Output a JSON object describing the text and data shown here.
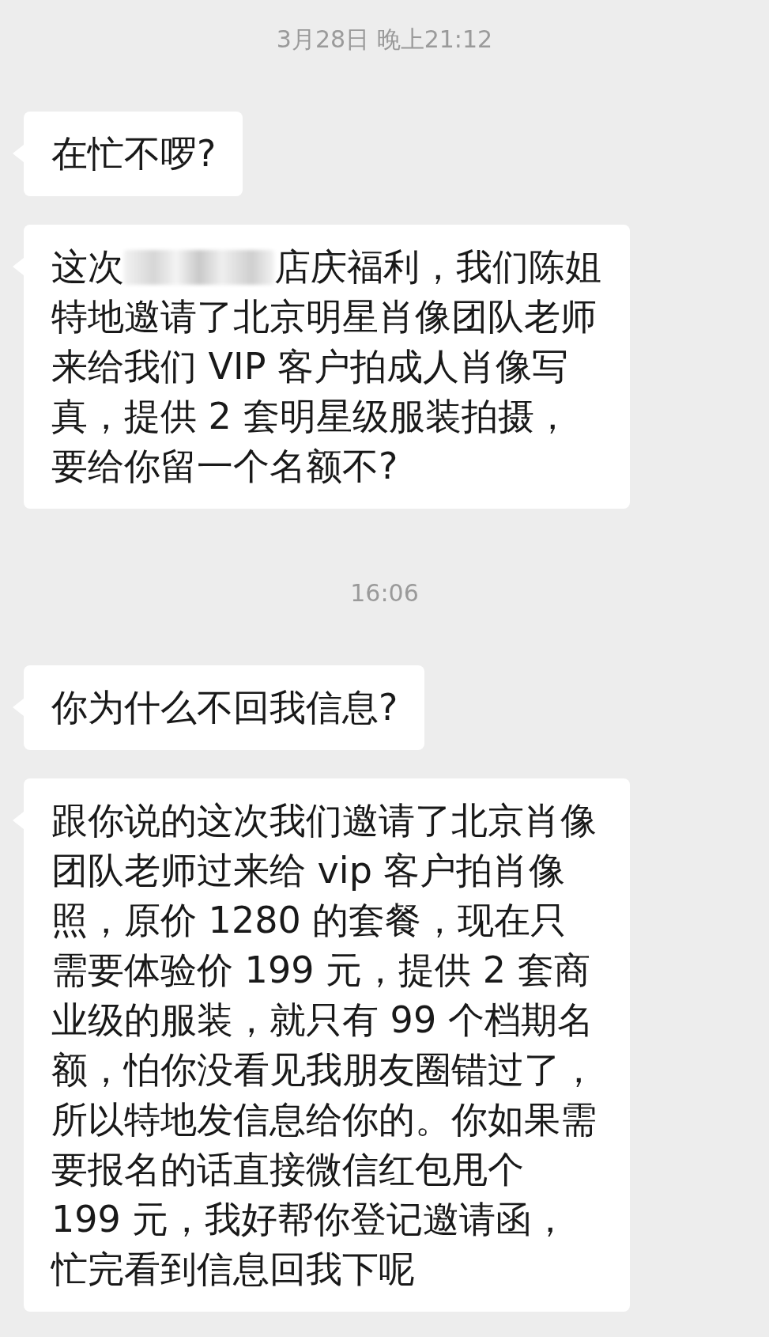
{
  "messages": [
    {
      "kind": "time",
      "text": "3月28日 晚上21:12"
    },
    {
      "kind": "bubble",
      "segments": [
        {
          "kind": "text",
          "text": "在忙不啰?"
        }
      ]
    },
    {
      "kind": "bubble",
      "segments": [
        {
          "kind": "text",
          "text": "这次"
        },
        {
          "kind": "blur"
        },
        {
          "kind": "text",
          "text": "店庆福利，我们陈姐"
        },
        {
          "kind": "text",
          "text": "特地邀请了北京明星肖像团队老师来给我们 VIP 客户拍成人肖像写真，提供 2 套明星级服装拍摄，要给你留一个名额不?"
        }
      ]
    },
    {
      "kind": "time",
      "text": "16:06"
    },
    {
      "kind": "bubble",
      "segments": [
        {
          "kind": "text",
          "text": "你为什么不回我信息?"
        }
      ]
    },
    {
      "kind": "bubble",
      "segments": [
        {
          "kind": "text",
          "text": "跟你说的这次我们邀请了北京肖像团队老师过来给 vip 客户拍肖像照，原价 1280 的套餐，现在只需要体验价 199 元，提供 2 套商业级的服装，就只有 99 个档期名额，怕你没看见我朋友圈错过了，所以特地发信息给你的。你如果需要报名的话直接微信红包甩个 199 元，我好帮你登记邀请函，忙完看到信息回我下呢"
        }
      ]
    }
  ]
}
